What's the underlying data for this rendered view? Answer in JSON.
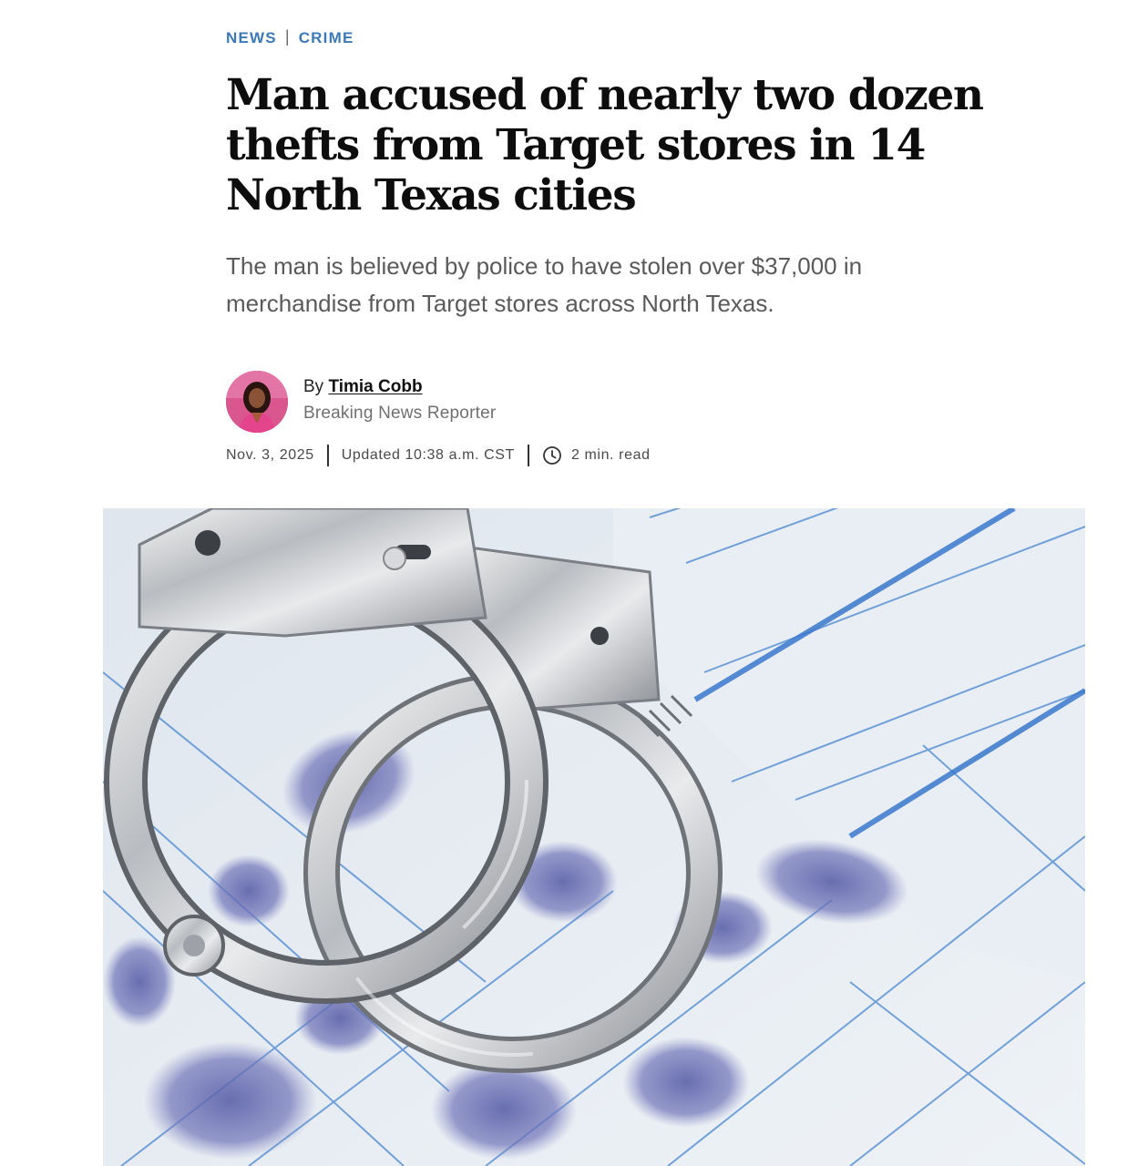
{
  "section": {
    "primary": "NEWS",
    "secondary": "CRIME"
  },
  "headline": "Man accused of nearly two dozen thefts from Target stores in 14 North Texas cities",
  "dek": "The man is believed by police to have stolen over $37,000 in merchandise from Target stores across North Texas.",
  "byline": {
    "prefix": "By",
    "author": "Timia Cobb",
    "title": "Breaking News Reporter"
  },
  "meta": {
    "date": "Nov. 3, 2025",
    "updated": "Updated 10:38 a.m. CST",
    "read_time": "2 min. read"
  },
  "hero_image": {
    "alt": "Handcuffs resting on a fingerprint card"
  },
  "colors": {
    "section_link": "#3b79b8",
    "headline": "#0d0d0d",
    "dek": "#5a5a5a"
  }
}
